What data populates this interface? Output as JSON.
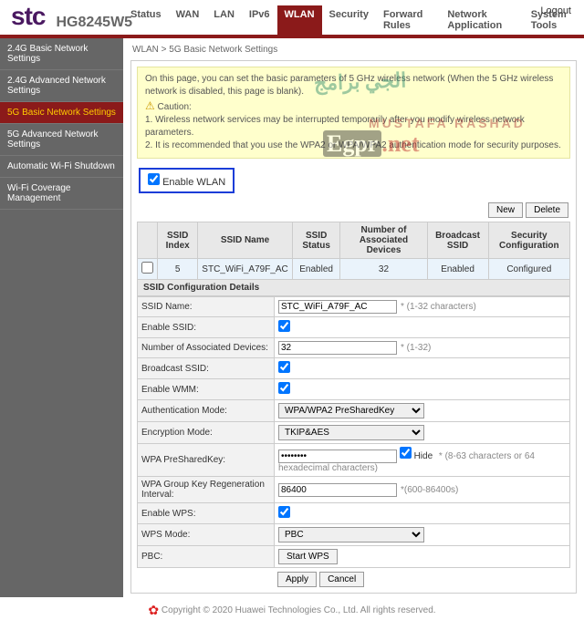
{
  "header": {
    "logo": "stc",
    "model": "HG8245W5",
    "logout": "Logout"
  },
  "topnav": {
    "items": [
      {
        "label": "Status"
      },
      {
        "label": "WAN"
      },
      {
        "label": "LAN"
      },
      {
        "label": "IPv6"
      },
      {
        "label": "WLAN"
      },
      {
        "label": "Security"
      },
      {
        "label": "Forward Rules"
      },
      {
        "label": "Network Application"
      },
      {
        "label": "System Tools"
      }
    ],
    "active": 4
  },
  "sidebar": {
    "items": [
      {
        "label": "2.4G Basic Network Settings"
      },
      {
        "label": "2.4G Advanced Network Settings"
      },
      {
        "label": "5G Basic Network Settings"
      },
      {
        "label": "5G Advanced Network Settings"
      },
      {
        "label": "Automatic Wi-Fi Shutdown"
      },
      {
        "label": "Wi-Fi Coverage Management"
      }
    ],
    "active": 2
  },
  "breadcrumb": "WLAN > 5G Basic Network Settings",
  "notice": {
    "intro": "On this page, you can set the basic parameters of 5 GHz wireless network (When the 5 GHz wireless network is disabled, this page is blank).",
    "caution_label": "Caution:",
    "line1": "1. Wireless network services may be interrupted temporarily after you modify wireless network parameters.",
    "line2": "2. It is recommended that you use the WPA2 or WPA/WPA2 authentication mode for security purposes."
  },
  "enable_wlan": {
    "label": "Enable WLAN",
    "checked": true
  },
  "buttons": {
    "new": "New",
    "delete": "Delete",
    "apply": "Apply",
    "cancel": "Cancel",
    "start_wps": "Start WPS"
  },
  "ssid_table": {
    "headers": [
      "SSID Index",
      "SSID Name",
      "SSID Status",
      "Number of Associated Devices",
      "Broadcast SSID",
      "Security Configuration"
    ],
    "row": {
      "index": "5",
      "name": "STC_WiFi_A79F_AC",
      "status": "Enabled",
      "devices": "32",
      "broadcast": "Enabled",
      "security": "Configured"
    }
  },
  "details_title": "SSID Configuration Details",
  "form": {
    "ssid_name": {
      "label": "SSID Name:",
      "value": "STC_WiFi_A79F_AC",
      "hint": "* (1-32 characters)"
    },
    "enable_ssid": {
      "label": "Enable SSID:",
      "checked": true
    },
    "assoc_devices": {
      "label": "Number of Associated Devices:",
      "value": "32",
      "hint": "* (1-32)"
    },
    "broadcast_ssid": {
      "label": "Broadcast SSID:",
      "checked": true
    },
    "enable_wmm": {
      "label": "Enable WMM:",
      "checked": true
    },
    "auth_mode": {
      "label": "Authentication Mode:",
      "value": "WPA/WPA2 PreSharedKey"
    },
    "enc_mode": {
      "label": "Encryption Mode:",
      "value": "TKIP&AES"
    },
    "psk": {
      "label": "WPA PreSharedKey:",
      "value": "••••••••",
      "hide_label": "Hide",
      "hide_checked": true,
      "hint": "* (8-63 characters or 64 hexadecimal characters)"
    },
    "rekey": {
      "label": "WPA Group Key Regeneration Interval:",
      "value": "86400",
      "hint": "*(600-86400s)"
    },
    "enable_wps": {
      "label": "Enable WPS:",
      "checked": true
    },
    "wps_mode": {
      "label": "WPS Mode:",
      "value": "PBC"
    },
    "pbc": {
      "label": "PBC:"
    }
  },
  "footer": "Copyright © 2020 Huawei Technologies Co., Ltd. All rights reserved.",
  "watermark": {
    "w1": "الجي برامج",
    "w2": "MUSTAFA RASHAD",
    "w3a": "Egpr",
    "w3b": ".net"
  }
}
